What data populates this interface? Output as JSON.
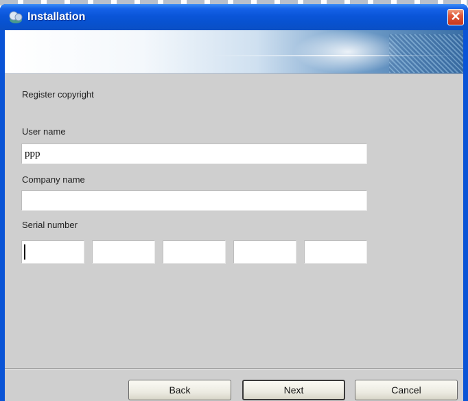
{
  "window": {
    "title": "Installation",
    "app_icon": "installer-icon",
    "close_icon": "close-icon",
    "close_glyph": "✕"
  },
  "form": {
    "heading": "Register copyright",
    "user_name_label": "User name",
    "user_name_value": "ppp",
    "company_name_label": "Company name",
    "company_name_value": "",
    "serial_number_label": "Serial number",
    "serial_parts": [
      "",
      "",
      "",
      "",
      ""
    ]
  },
  "buttons": {
    "back": "Back",
    "next": "Next",
    "cancel": "Cancel"
  },
  "colors": {
    "titlebar": "#0a55d8",
    "body": "#cfcfcf",
    "close": "#e0583a"
  }
}
